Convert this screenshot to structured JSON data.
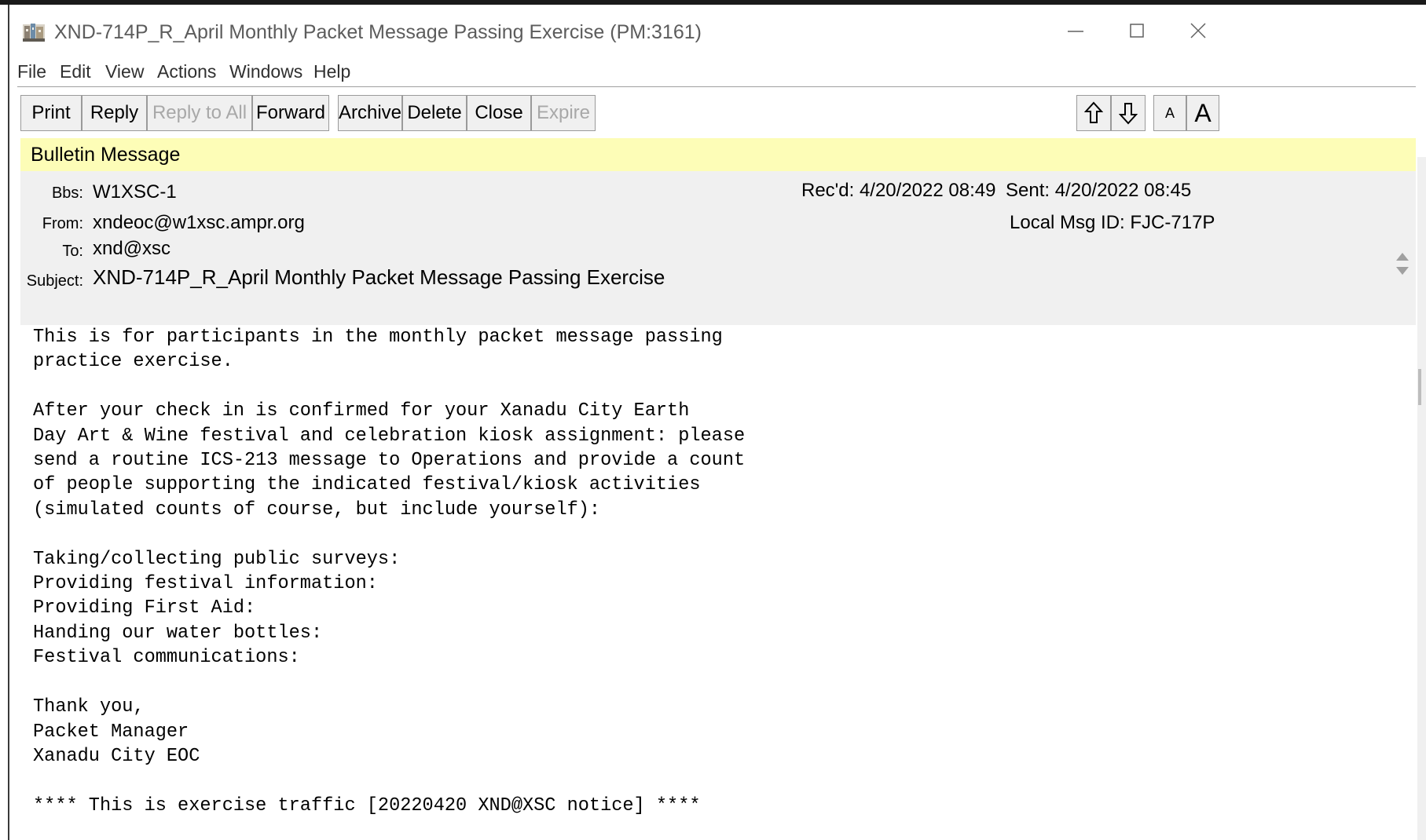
{
  "window": {
    "title": "XND-714P_R_April Monthly Packet Message Passing Exercise  (PM:3161)"
  },
  "menu": [
    "File",
    "Edit",
    "View",
    "Actions",
    "Windows",
    "Help"
  ],
  "toolbar": {
    "print": "Print",
    "reply": "Reply",
    "reply_all": "Reply to All",
    "forward": "Forward",
    "archive": "Archive",
    "delete": "Delete",
    "close": "Close",
    "expire": "Expire",
    "font_small": "A",
    "font_large": "A"
  },
  "band": {
    "label": "Bulletin Message"
  },
  "header": {
    "bbs_label": "Bbs:",
    "bbs": "W1XSC-1",
    "from_label": "From:",
    "from": "xndeoc@w1xsc.ampr.org",
    "to_label": "To:",
    "to": "xnd@xsc",
    "subject_label": "Subject:",
    "subject": "XND-714P_R_April Monthly Packet Message Passing Exercise",
    "recd": "Rec'd:  4/20/2022 08:49",
    "sent": "Sent:  4/20/2022 08:45",
    "local_msg_id": "Local Msg ID:  FJC-717P"
  },
  "body": {
    "text": "This is for participants in the monthly packet message passing\npractice exercise.\n\nAfter your check in is confirmed for your Xanadu City Earth\nDay Art & Wine festival and celebration kiosk assignment: please\nsend a routine ICS-213 message to Operations and provide a count\nof people supporting the indicated festival/kiosk activities\n(simulated counts of course, but include yourself):\n\nTaking/collecting public surveys:\nProviding festival information:\nProviding First Aid:\nHanding our water bottles:\nFestival communications:\n\nThank you,\nPacket Manager\nXanadu City EOC\n\n**** This is exercise traffic [20220420 XND@XSC notice] ****"
  },
  "colors": {
    "band": "#fdfdb7",
    "header_bg": "#f0f0f0",
    "button_bg": "#f0f0f0",
    "disabled_text": "#a8a8a8"
  },
  "icons": {
    "app": "packet-app-icon",
    "minimize": "minimize-icon",
    "maximize": "maximize-icon",
    "close": "close-icon",
    "prev": "up-arrow-icon",
    "next": "down-arrow-icon",
    "spin": "spin-arrows-icon"
  }
}
